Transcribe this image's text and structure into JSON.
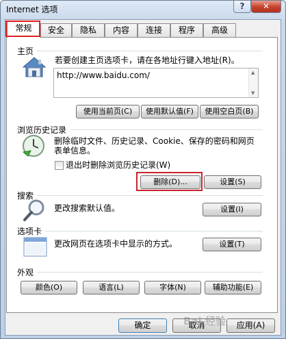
{
  "window": {
    "title": "Internet 选项",
    "help_label": "?",
    "close_label": "✕"
  },
  "tabs": [
    {
      "label": "常规",
      "active": true
    },
    {
      "label": "安全"
    },
    {
      "label": "隐私"
    },
    {
      "label": "内容"
    },
    {
      "label": "连接"
    },
    {
      "label": "程序"
    },
    {
      "label": "高级"
    }
  ],
  "home": {
    "label": "主页",
    "desc": "若要创建主页选项卡，请在各地址行键入地址(R)。",
    "url": "http://www.baidu.com/",
    "icon": "house-icon",
    "buttons": [
      "使用当前页(C)",
      "使用默认值(F)",
      "使用空白页(B)"
    ]
  },
  "history": {
    "label": "浏览历史记录",
    "desc_line1": "删除临时文件、历史记录、Cookie、保存的密码和网页",
    "desc_line2": "表单信息。",
    "checkbox_label": "退出时删除浏览历史记录(W)",
    "checked": false,
    "icon": "clock-icon",
    "delete_label": "删除(D)...",
    "settings_label": "设置(S)"
  },
  "search": {
    "label": "搜索",
    "desc": "更改搜索默认值。",
    "icon": "magnifier-icon",
    "settings_label": "设置(I)"
  },
  "tabbed": {
    "label": "选项卡",
    "desc": "更改网页在选项卡中显示的方式。",
    "icon": "window-icon",
    "settings_label": "设置(T)"
  },
  "appearance": {
    "label": "外观",
    "buttons": [
      "颜色(O)",
      "语言(L)",
      "字体(N)",
      "辅助功能(E)"
    ]
  },
  "footer": {
    "ok": "确定",
    "cancel": "取消",
    "apply": "应用(A)"
  },
  "watermark": "Bai 经验",
  "colors": {
    "highlight": "#c8232c",
    "accent": "#3c7fb1"
  }
}
